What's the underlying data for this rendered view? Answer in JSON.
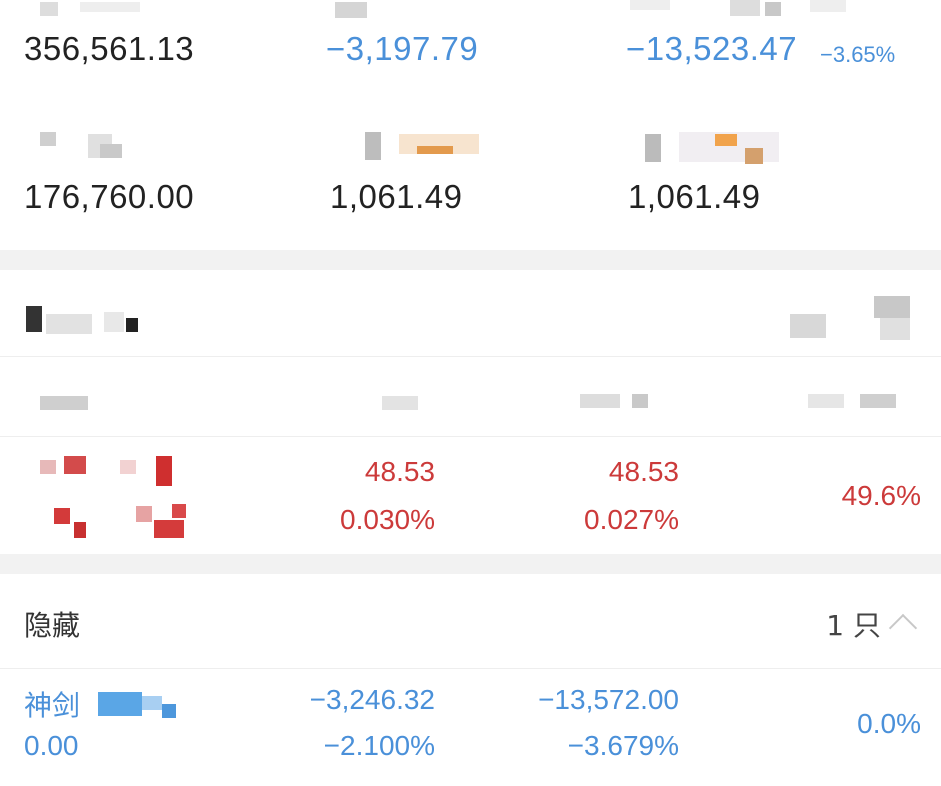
{
  "summary": {
    "row1": {
      "a": "356,561.13",
      "b": "−3,197.79",
      "c": "−13,523.47",
      "c_pct": "−3.65%"
    },
    "row2": {
      "a": "176,760.00",
      "b": "1,061.49",
      "c": "1,061.49"
    }
  },
  "holding": {
    "row": {
      "col2_top": "48.53",
      "col2_bottom": "0.030%",
      "col3_top": "48.53",
      "col3_bottom": "0.027%",
      "col4": "49.6%"
    }
  },
  "hidden_section": {
    "title": "隐藏",
    "count": "1 只",
    "row": {
      "name": "神剑",
      "value": "0.00",
      "col2_top": "−3,246.32",
      "col2_bottom": "−2.100%",
      "col3_top": "−13,572.00",
      "col3_bottom": "−3.679%",
      "col4": "0.0%"
    }
  },
  "colors": {
    "loss_blue": "#4a90d9",
    "gain_red": "#cc3a3a",
    "text_dark": "#222222",
    "background": "#f2f2f2"
  },
  "icons": {
    "collapse": "chevron-up-icon"
  }
}
